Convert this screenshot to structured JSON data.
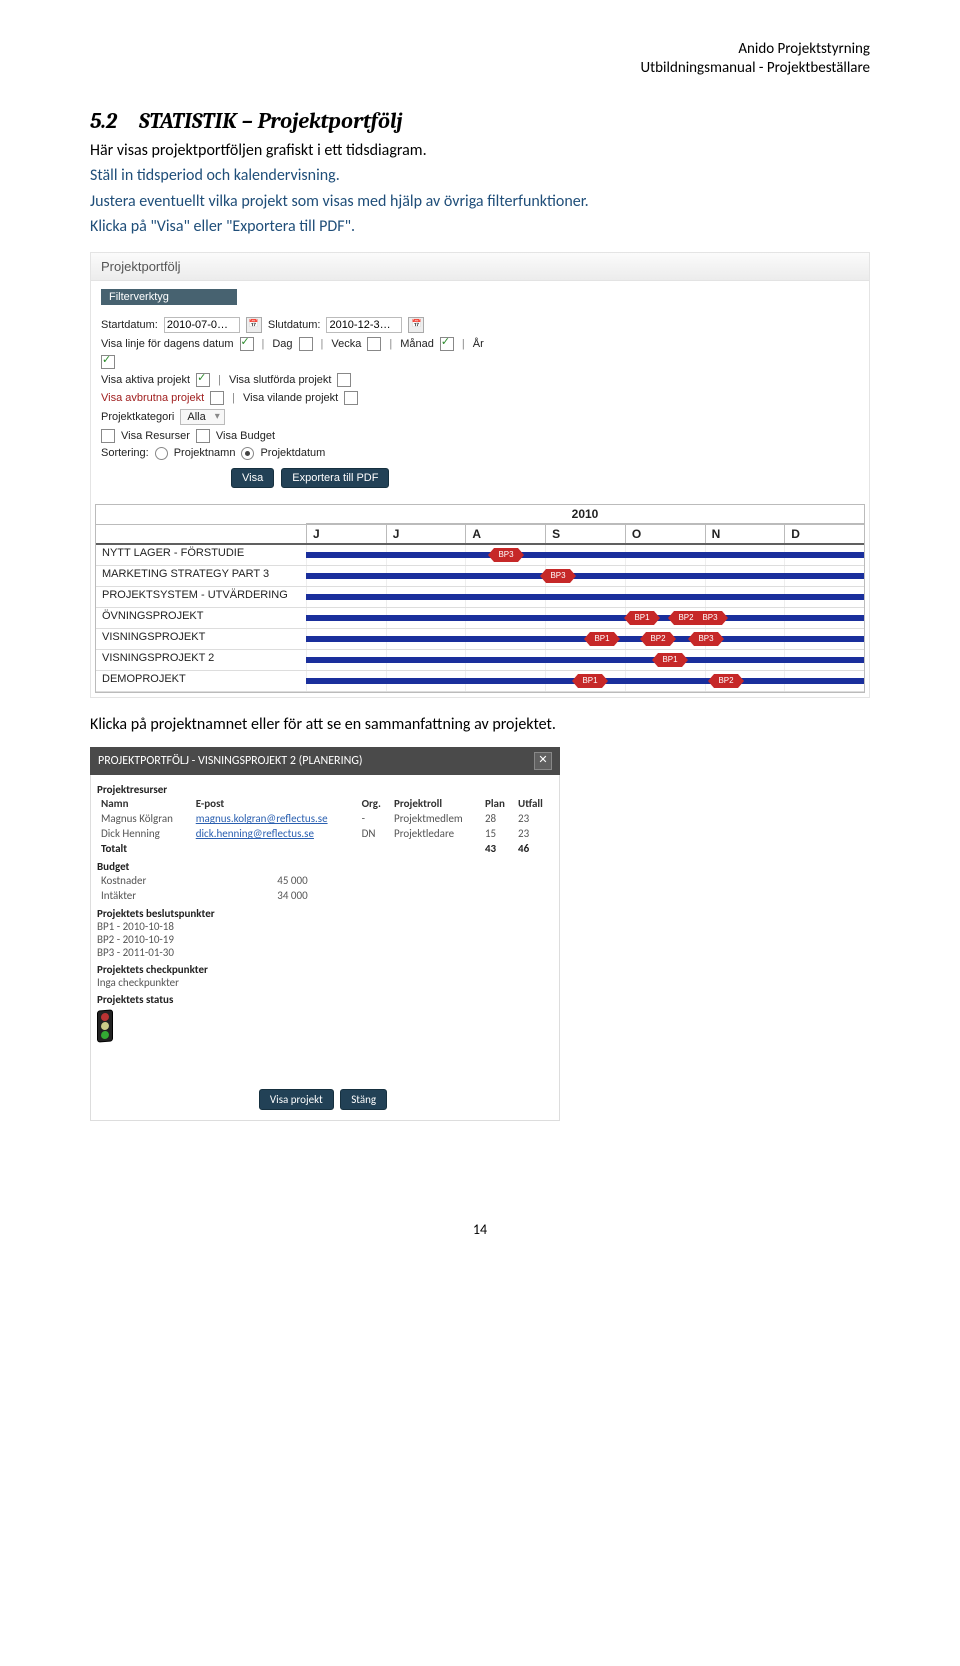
{
  "header": {
    "line1": "Anido Projektstyrning",
    "line2": "Utbildningsmanual - Projektbeställare"
  },
  "section": {
    "number": "5.2",
    "title": "STATISTIK – Projektportfölj"
  },
  "intro": "Här visas projektportföljen grafiskt i ett tidsdiagram.",
  "action1": "Ställ in tidsperiod och kalendervisning.",
  "action2": "Justera eventuellt vilka projekt som visas med hjälp av övriga filterfunktioner.",
  "action3": "Klicka på \"Visa\" eller \"Exportera till PDF\".",
  "caption2": "Klicka på projektnamnet eller för att se en sammanfattning av projektet.",
  "panel": {
    "title": "Projektportfölj",
    "filter_label": "Filterverktyg",
    "start_label": "Startdatum:",
    "start_value": "2010-07-0…",
    "end_label": "Slutdatum:",
    "end_value": "2010-12-3…",
    "today_line": "Visa linje för dagens datum",
    "day": "Dag",
    "week": "Vecka",
    "month": "Månad",
    "year": "År",
    "active": "Visa aktiva projekt",
    "finished": "Visa slutförda projekt",
    "aborted": "Visa avbrutna projekt",
    "paused": "Visa vilande projekt",
    "cat_label": "Projektkategori",
    "cat_value": "Alla",
    "show_res": "Visa Resurser",
    "show_bud": "Visa Budget",
    "sort_label": "Sortering:",
    "sort_name": "Projektnamn",
    "sort_date": "Projektdatum",
    "btn_show": "Visa",
    "btn_pdf": "Exportera till PDF"
  },
  "gantt": {
    "year": "2010",
    "months": [
      "J",
      "J",
      "A",
      "S",
      "O",
      "N",
      "D"
    ],
    "rows": [
      {
        "name": "NYTT LAGER - FÖRSTUDIE",
        "marks": [
          {
            "label": "BP3",
            "monthIdx": 2,
            "frac": 0.5
          }
        ]
      },
      {
        "name": "MARKETING STRATEGY PART 3",
        "marks": [
          {
            "label": "BP3",
            "monthIdx": 3,
            "frac": 0.15
          }
        ]
      },
      {
        "name": "PROJEKTSYSTEM - UTVÄRDERING",
        "marks": []
      },
      {
        "name": "ÖVNINGSPROJEKT",
        "marks": [
          {
            "label": "BP1",
            "monthIdx": 4,
            "frac": 0.2
          },
          {
            "label": "BP2",
            "monthIdx": 4,
            "frac": 0.75
          },
          {
            "label": "BP3",
            "monthIdx": 5,
            "frac": 0.05
          }
        ]
      },
      {
        "name": "VISNINGSPROJEKT",
        "marks": [
          {
            "label": "BP1",
            "monthIdx": 3,
            "frac": 0.7
          },
          {
            "label": "BP2",
            "monthIdx": 4,
            "frac": 0.4
          },
          {
            "label": "BP3",
            "monthIdx": 5,
            "frac": 0.0
          }
        ]
      },
      {
        "name": "VISNINGSPROJEKT 2",
        "marks": [
          {
            "label": "BP1",
            "monthIdx": 4,
            "frac": 0.55
          }
        ]
      },
      {
        "name": "DEMOPROJEKT",
        "marks": [
          {
            "label": "BP1",
            "monthIdx": 3,
            "frac": 0.55
          },
          {
            "label": "BP2",
            "monthIdx": 5,
            "frac": 0.25
          }
        ]
      }
    ]
  },
  "popup": {
    "title": "PROJEKTPORTFÖLJ - VISNINGSPROJEKT 2 (PLANERING)",
    "res_head": "Projektresurser",
    "cols": {
      "name": "Namn",
      "email": "E-post",
      "org": "Org.",
      "role": "Projektroll",
      "plan": "Plan",
      "utfall": "Utfall"
    },
    "resources": [
      {
        "name": "Magnus Kölgran",
        "email": "magnus.kolgran@reflectus.se",
        "org": "-",
        "role": "Projektmedlem",
        "plan": "28",
        "utfall": "23"
      },
      {
        "name": "Dick Henning",
        "email": "dick.henning@reflectus.se",
        "org": "DN",
        "role": "Projektledare",
        "plan": "15",
        "utfall": "23"
      }
    ],
    "total_label": "Totalt",
    "total_plan": "43",
    "total_utfall": "46",
    "budget_head": "Budget",
    "cost_label": "Kostnader",
    "cost_value": "45 000",
    "income_label": "Intäkter",
    "income_value": "34 000",
    "bp_head": "Projektets beslutspunkter",
    "bps": [
      "BP1 - 2010-10-18",
      "BP2 - 2010-10-19",
      "BP3 - 2011-01-30"
    ],
    "cp_head": "Projektets checkpunkter",
    "cp_none": "Inga checkpunkter",
    "status_head": "Projektets status",
    "btn_open": "Visa projekt",
    "btn_close": "Stäng"
  },
  "pagenum": "14"
}
